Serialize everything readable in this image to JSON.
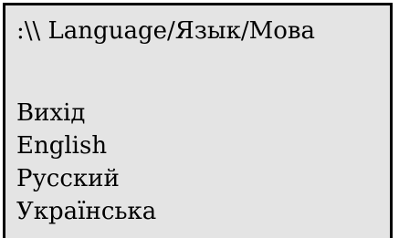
{
  "header": {
    "title": ":\\\\ Language/Язык/Мова"
  },
  "menu": {
    "items": [
      {
        "label": "Вихід"
      },
      {
        "label": "English"
      },
      {
        "label": "Русский"
      },
      {
        "label": "Українська"
      }
    ]
  },
  "colors": {
    "background": "#e4e4e4",
    "border": "#000000",
    "text": "#000000"
  }
}
